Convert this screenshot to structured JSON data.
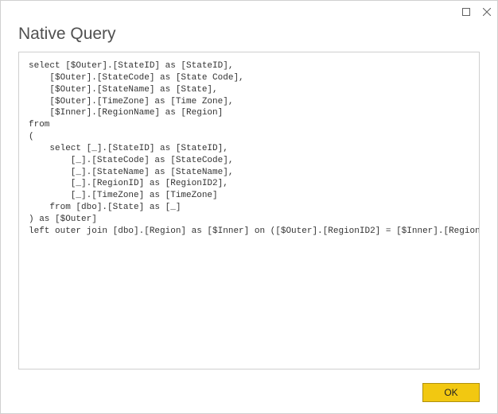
{
  "dialog": {
    "title": "Native Query",
    "query": "select [$Outer].[StateID] as [StateID],\n    [$Outer].[StateCode] as [State Code],\n    [$Outer].[StateName] as [State],\n    [$Outer].[TimeZone] as [Time Zone],\n    [$Inner].[RegionName] as [Region]\nfrom \n(\n    select [_].[StateID] as [StateID],\n        [_].[StateCode] as [StateCode],\n        [_].[StateName] as [StateName],\n        [_].[RegionID] as [RegionID2],\n        [_].[TimeZone] as [TimeZone]\n    from [dbo].[State] as [_]\n) as [$Outer]\nleft outer join [dbo].[Region] as [$Inner] on ([$Outer].[RegionID2] = [$Inner].[RegionID])",
    "ok_label": "OK"
  }
}
